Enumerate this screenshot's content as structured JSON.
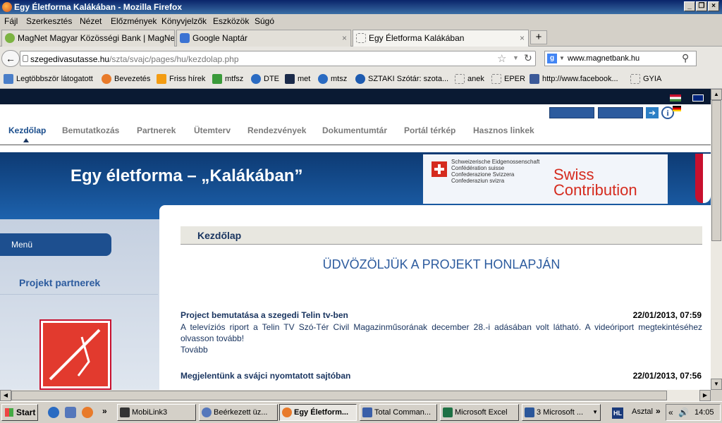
{
  "window": {
    "title": "Egy Életforma Kalákában - Mozilla Firefox"
  },
  "menubar": [
    "Fájl",
    "Szerkesztés",
    "Nézet",
    "Előzmények",
    "Könyvjelzők",
    "Eszközök",
    "Súgó"
  ],
  "tabs": [
    {
      "label": "MagNet Magyar Közösségi Bank | MagNe..."
    },
    {
      "label": "Google Naptár"
    },
    {
      "label": "Egy Életforma Kalákában"
    }
  ],
  "url": {
    "host": "szegedivasutasse.hu",
    "path": "/szta/svajc/pages/hu/kezdolap.php"
  },
  "search": {
    "value": "www.magnetbank.hu"
  },
  "bookmarks": [
    "Legtöbbször látogatott",
    "Bevezetés",
    "Friss hírek",
    "mtfsz",
    "DTE",
    "met",
    "mtsz",
    "SZTAKI Szótár: szota...",
    "anek",
    "EPER",
    "http://www.facebook...",
    "GYIA"
  ],
  "site": {
    "nav": [
      "Kezdőlap",
      "Bemutatkozás",
      "Partnerek",
      "Ütemterv",
      "Rendezvények",
      "Dokumentumtár",
      "Portál térkép",
      "Hasznos linkek"
    ],
    "banner_title": "Egy életforma – „Kalákában”",
    "swiss_names": [
      "Schweizerische Eidgenossenschaft",
      "Confédération suisse",
      "Confederazione Svizzera",
      "Confederaziun svizra"
    ],
    "swiss_contribution": [
      "Swiss",
      "Contribution"
    ],
    "info_glyph": "i",
    "sidebar": {
      "menu_label": "Menü",
      "partners_heading": "Projekt partnerek"
    },
    "page_heading": "Kezdőlap",
    "welcome": "ÜDVÖZÖLJÜK A PROJEKT HONLAPJÁN",
    "news": [
      {
        "title": "Project bemutatása a szegedi Telin tv-ben",
        "date": "22/01/2013, 07:59",
        "body": "A televíziós riport a Telin TV Szó-Tér Civil Magazinműsorának december 28.-i adásában volt látható. A videóriport megtekintéséhez olvasson tovább!",
        "more": "Tovább"
      },
      {
        "title": "Megjelentünk a svájci nyomtatott sajtóban",
        "date": "22/01/2013, 07:56"
      }
    ]
  },
  "taskbar": {
    "start": "Start",
    "items": [
      "MobiLink3",
      "Beérkezett üz...",
      "Egy Életform...",
      "Total Comman...",
      "Microsoft Excel",
      "3 Microsoft ..."
    ],
    "tray_text": "Asztal",
    "clock": "14:05",
    "hl_label": "HL"
  }
}
